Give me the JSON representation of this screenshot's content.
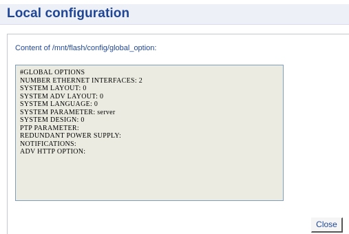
{
  "header": {
    "title": "Local configuration"
  },
  "panel": {
    "content_label": "Content of /mnt/flash/config/global_option:",
    "file_lines": [
      "#GLOBAL OPTIONS",
      "",
      "NUMBER ETHERNET INTERFACES: 2",
      "SYSTEM LAYOUT: 0",
      "SYSTEM ADV LAYOUT: 0",
      "SYSTEM LANGUAGE: 0",
      "SYSTEM PARAMETER: server",
      "SYSTEM DESIGN: 0",
      "PTP PARAMETER:",
      "REDUNDANT POWER SUPPLY:",
      "NOTIFICATIONS:",
      "ADV HTTP OPTION:"
    ]
  },
  "actions": {
    "close_label": "Close"
  },
  "colors": {
    "title": "#1f4696",
    "header_bg": "#eef0f7",
    "file_box_bg": "#ebebe1",
    "file_box_border": "#7f9db9"
  }
}
